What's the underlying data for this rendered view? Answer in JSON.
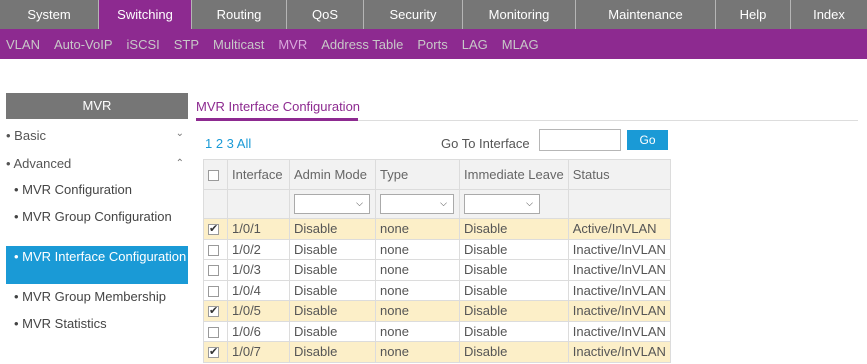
{
  "topnav": [
    "System",
    "Switching",
    "Routing",
    "QoS",
    "Security",
    "Monitoring",
    "Maintenance",
    "Help",
    "Index"
  ],
  "subnav": [
    "VLAN",
    "Auto-VoIP",
    "iSCSI",
    "STP",
    "Multicast",
    "MVR",
    "Address Table",
    "Ports",
    "LAG",
    "MLAG"
  ],
  "sidebar": {
    "title": "MVR",
    "basic": "Basic",
    "advanced": "Advanced",
    "items": [
      "MVR Configuration",
      "MVR Group Configuration",
      "MVR Interface Configuration",
      "MVR Group Membership",
      "MVR Statistics"
    ]
  },
  "panel": {
    "title": "MVR Interface Configuration",
    "pages": "1 2 3 All",
    "goto_label": "Go To Interface",
    "go_button": "Go"
  },
  "table": {
    "headers": [
      "Interface",
      "Admin Mode",
      "Type",
      "Immediate Leave",
      "Status"
    ],
    "rows": [
      {
        "checked": true,
        "interface": "1/0/1",
        "admin": "Disable",
        "type": "none",
        "leave": "Disable",
        "status": "Active/InVLAN"
      },
      {
        "checked": false,
        "interface": "1/0/2",
        "admin": "Disable",
        "type": "none",
        "leave": "Disable",
        "status": "Inactive/InVLAN"
      },
      {
        "checked": false,
        "interface": "1/0/3",
        "admin": "Disable",
        "type": "none",
        "leave": "Disable",
        "status": "Inactive/InVLAN"
      },
      {
        "checked": false,
        "interface": "1/0/4",
        "admin": "Disable",
        "type": "none",
        "leave": "Disable",
        "status": "Inactive/InVLAN"
      },
      {
        "checked": true,
        "interface": "1/0/5",
        "admin": "Disable",
        "type": "none",
        "leave": "Disable",
        "status": "Inactive/InVLAN"
      },
      {
        "checked": false,
        "interface": "1/0/6",
        "admin": "Disable",
        "type": "none",
        "leave": "Disable",
        "status": "Inactive/InVLAN"
      },
      {
        "checked": true,
        "interface": "1/0/7",
        "admin": "Disable",
        "type": "none",
        "leave": "Disable",
        "status": "Inactive/InVLAN"
      }
    ]
  },
  "colors": {
    "accent": "#8d2a90",
    "nav_gray": "#767676",
    "highlight_blue": "#1a9ad6",
    "selected_row": "#fcefc8"
  }
}
